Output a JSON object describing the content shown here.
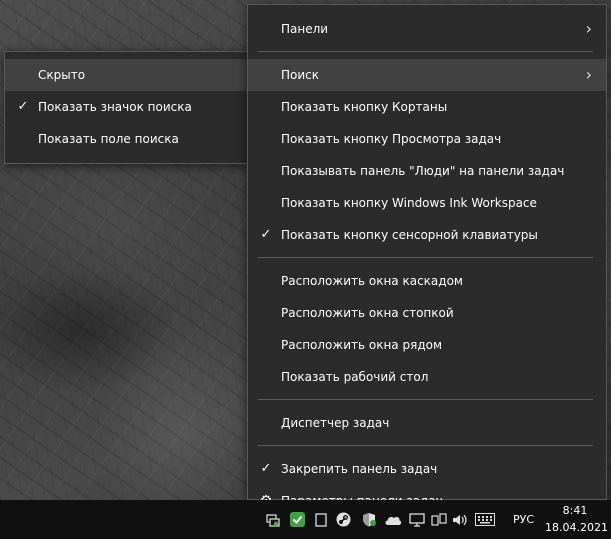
{
  "main_menu": {
    "items": [
      {
        "label": "Панели",
        "submenu": true
      },
      {
        "label": "Поиск",
        "submenu": true,
        "highlighted": true
      },
      {
        "label": "Показать кнопку Кортаны"
      },
      {
        "label": "Показать кнопку Просмотра задач"
      },
      {
        "label": "Показывать панель \"Люди\" на панели задач"
      },
      {
        "label": "Показать кнопку Windows Ink Workspace"
      },
      {
        "label": "Показать кнопку сенсорной клавиатуры",
        "checked": true
      },
      {
        "label": "Расположить окна каскадом"
      },
      {
        "label": "Расположить окна стопкой"
      },
      {
        "label": "Расположить окна рядом"
      },
      {
        "label": "Показать рабочий стол"
      },
      {
        "label": "Диспетчер задач"
      },
      {
        "label": "Закрепить панель задач",
        "checked": true
      },
      {
        "label": "Параметры панели задач",
        "icon": "gear-icon"
      }
    ]
  },
  "search_submenu": {
    "items": [
      {
        "label": "Скрыто",
        "highlighted": true
      },
      {
        "label": "Показать значок поиска",
        "checked": true
      },
      {
        "label": "Показать поле поиска"
      }
    ]
  },
  "taskbar": {
    "language": "РУС",
    "time": "8:41",
    "date": "18.04.2021",
    "tray_icons": [
      "network-activity-icon",
      "security-shield-icon",
      "clipboard-icon",
      "steam-icon",
      "defender-icon",
      "onedrive-cloud-icon",
      "display-icon",
      "wifi-icon",
      "volume-icon",
      "pen-icon",
      "keyboard-icon"
    ]
  },
  "glyphs": {
    "check": "✓",
    "chevron": "›",
    "gear": "⚙"
  },
  "colors": {
    "menu_bg": "#2b2b2b",
    "highlight": "#414141",
    "taskbar": "#101010"
  }
}
